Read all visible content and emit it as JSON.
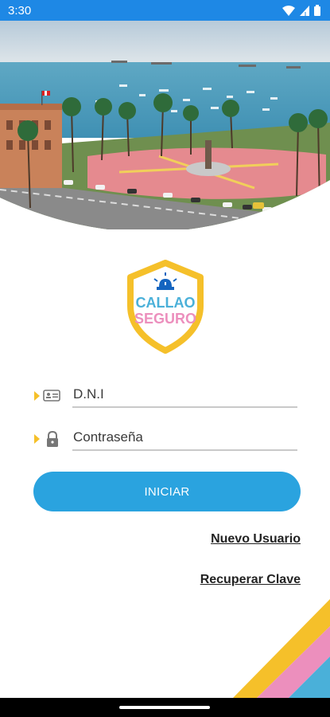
{
  "status_bar": {
    "time": "3:30",
    "icons": [
      "wifi-icon",
      "signal-icon",
      "battery-icon"
    ]
  },
  "logo": {
    "line1": "CALLAO",
    "line2": "SEGURO"
  },
  "form": {
    "dni_placeholder": "D.N.I",
    "password_placeholder": "Contraseña",
    "login_label": "INICIAR"
  },
  "links": {
    "new_user": "Nuevo Usuario",
    "recover": "Recuperar Clave"
  },
  "colors": {
    "accent": "#2aa3df",
    "status_bar": "#1e88e5",
    "yellow": "#f5c02a",
    "pink": "#ec8fbd",
    "blue_text": "#4ab0d9"
  }
}
